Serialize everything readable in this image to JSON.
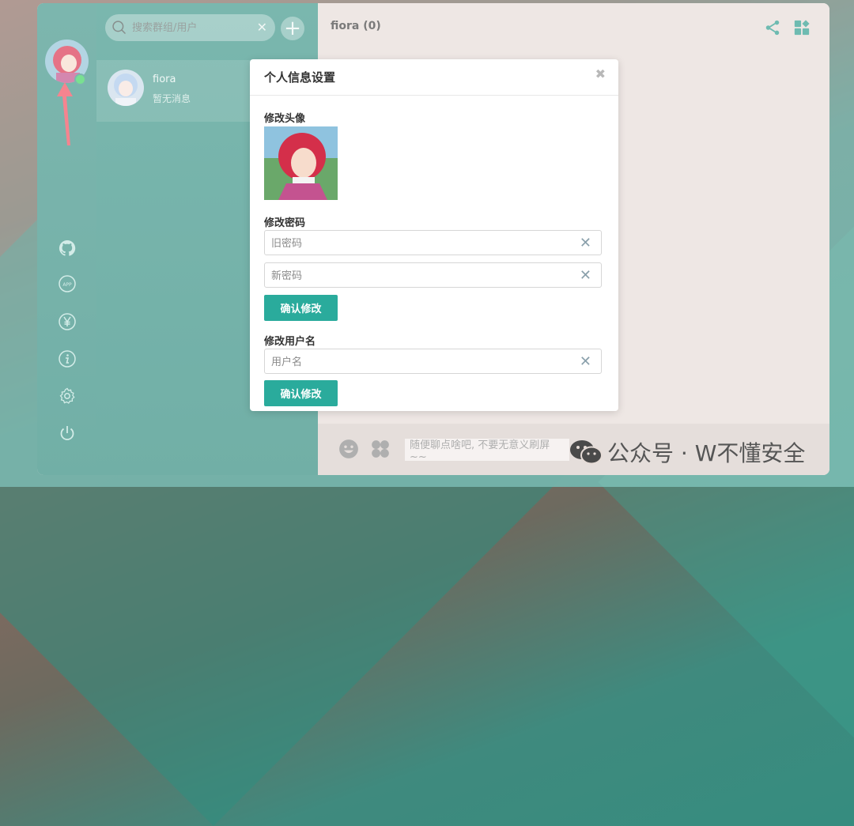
{
  "contacts": {
    "search_placeholder": "搜索群组/用户",
    "items": [
      {
        "name": "fiora",
        "last_message": "暂无消息"
      }
    ]
  },
  "chat": {
    "title": "fiora (0)",
    "input_placeholder": "随便聊点啥吧, 不要无意义刷屏~~"
  },
  "modal": {
    "title": "个人信息设置",
    "avatar_section": "修改头像",
    "password_section": "修改密码",
    "old_password_placeholder": "旧密码",
    "new_password_placeholder": "新密码",
    "confirm_label": "确认修改",
    "username_section": "修改用户名",
    "username_placeholder": "用户名",
    "confirm_label_2": "确认修改"
  },
  "watermark": {
    "text": "公众号 · W不懂安全"
  },
  "icons": {
    "rail": [
      "github-icon",
      "app-icon",
      "yen-icon",
      "info-icon",
      "settings-icon",
      "power-icon"
    ]
  },
  "colors": {
    "accent": "#2aab9c",
    "online": "#3ad15d"
  }
}
